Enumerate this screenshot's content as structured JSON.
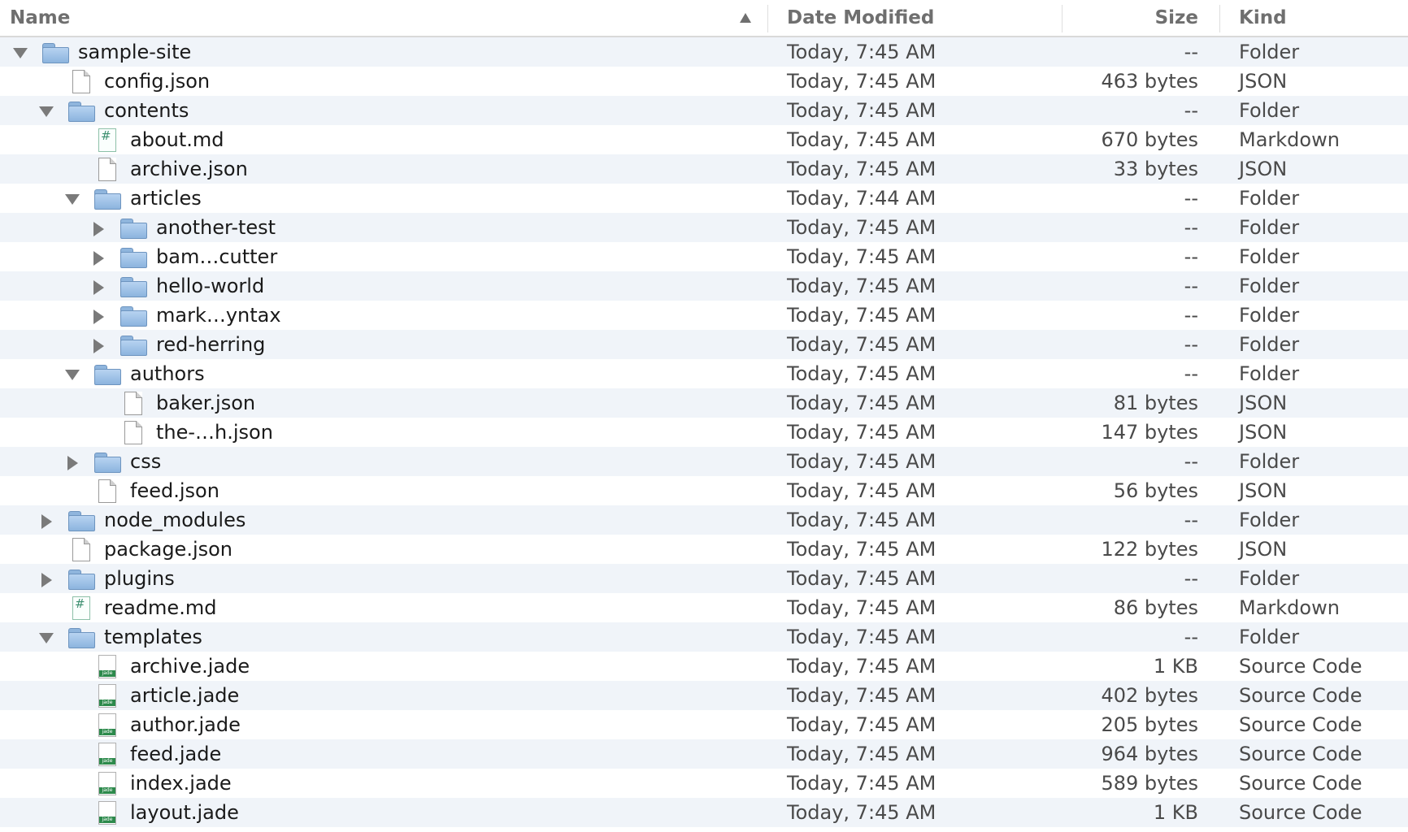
{
  "header": {
    "name": "Name",
    "date": "Date Modified",
    "size": "Size",
    "kind": "Kind"
  },
  "rows": [
    {
      "name": "sample-site",
      "date": "Today, 7:45 AM",
      "size": "--",
      "kind": "Folder",
      "depth": 0,
      "type": "folder",
      "disclosure": "open"
    },
    {
      "name": "config.json",
      "date": "Today, 7:45 AM",
      "size": "463 bytes",
      "kind": "JSON",
      "depth": 1,
      "type": "file",
      "disclosure": "none"
    },
    {
      "name": "contents",
      "date": "Today, 7:45 AM",
      "size": "--",
      "kind": "Folder",
      "depth": 1,
      "type": "folder",
      "disclosure": "open"
    },
    {
      "name": "about.md",
      "date": "Today, 7:45 AM",
      "size": "670 bytes",
      "kind": "Markdown",
      "depth": 2,
      "type": "md",
      "disclosure": "none"
    },
    {
      "name": "archive.json",
      "date": "Today, 7:45 AM",
      "size": "33 bytes",
      "kind": "JSON",
      "depth": 2,
      "type": "file",
      "disclosure": "none"
    },
    {
      "name": "articles",
      "date": "Today, 7:44 AM",
      "size": "--",
      "kind": "Folder",
      "depth": 2,
      "type": "folder",
      "disclosure": "open"
    },
    {
      "name": "another-test",
      "date": "Today, 7:45 AM",
      "size": "--",
      "kind": "Folder",
      "depth": 3,
      "type": "folder",
      "disclosure": "closed"
    },
    {
      "name": "bam…cutter",
      "date": "Today, 7:45 AM",
      "size": "--",
      "kind": "Folder",
      "depth": 3,
      "type": "folder",
      "disclosure": "closed"
    },
    {
      "name": "hello-world",
      "date": "Today, 7:45 AM",
      "size": "--",
      "kind": "Folder",
      "depth": 3,
      "type": "folder",
      "disclosure": "closed"
    },
    {
      "name": "mark…yntax",
      "date": "Today, 7:45 AM",
      "size": "--",
      "kind": "Folder",
      "depth": 3,
      "type": "folder",
      "disclosure": "closed"
    },
    {
      "name": "red-herring",
      "date": "Today, 7:45 AM",
      "size": "--",
      "kind": "Folder",
      "depth": 3,
      "type": "folder",
      "disclosure": "closed"
    },
    {
      "name": "authors",
      "date": "Today, 7:45 AM",
      "size": "--",
      "kind": "Folder",
      "depth": 2,
      "type": "folder",
      "disclosure": "open"
    },
    {
      "name": "baker.json",
      "date": "Today, 7:45 AM",
      "size": "81 bytes",
      "kind": "JSON",
      "depth": 3,
      "type": "file",
      "disclosure": "none"
    },
    {
      "name": "the-…h.json",
      "date": "Today, 7:45 AM",
      "size": "147 bytes",
      "kind": "JSON",
      "depth": 3,
      "type": "file",
      "disclosure": "none"
    },
    {
      "name": "css",
      "date": "Today, 7:45 AM",
      "size": "--",
      "kind": "Folder",
      "depth": 2,
      "type": "folder",
      "disclosure": "closed"
    },
    {
      "name": "feed.json",
      "date": "Today, 7:45 AM",
      "size": "56 bytes",
      "kind": "JSON",
      "depth": 2,
      "type": "file",
      "disclosure": "none"
    },
    {
      "name": "node_modules",
      "date": "Today, 7:45 AM",
      "size": "--",
      "kind": "Folder",
      "depth": 1,
      "type": "folder",
      "disclosure": "closed"
    },
    {
      "name": "package.json",
      "date": "Today, 7:45 AM",
      "size": "122 bytes",
      "kind": "JSON",
      "depth": 1,
      "type": "file",
      "disclosure": "none"
    },
    {
      "name": "plugins",
      "date": "Today, 7:45 AM",
      "size": "--",
      "kind": "Folder",
      "depth": 1,
      "type": "folder",
      "disclosure": "closed"
    },
    {
      "name": "readme.md",
      "date": "Today, 7:45 AM",
      "size": "86 bytes",
      "kind": "Markdown",
      "depth": 1,
      "type": "md",
      "disclosure": "none"
    },
    {
      "name": "templates",
      "date": "Today, 7:45 AM",
      "size": "--",
      "kind": "Folder",
      "depth": 1,
      "type": "folder",
      "disclosure": "open"
    },
    {
      "name": "archive.jade",
      "date": "Today, 7:45 AM",
      "size": "1 KB",
      "kind": "Source Code",
      "depth": 2,
      "type": "jade",
      "disclosure": "none"
    },
    {
      "name": "article.jade",
      "date": "Today, 7:45 AM",
      "size": "402 bytes",
      "kind": "Source Code",
      "depth": 2,
      "type": "jade",
      "disclosure": "none"
    },
    {
      "name": "author.jade",
      "date": "Today, 7:45 AM",
      "size": "205 bytes",
      "kind": "Source Code",
      "depth": 2,
      "type": "jade",
      "disclosure": "none"
    },
    {
      "name": "feed.jade",
      "date": "Today, 7:45 AM",
      "size": "964 bytes",
      "kind": "Source Code",
      "depth": 2,
      "type": "jade",
      "disclosure": "none"
    },
    {
      "name": "index.jade",
      "date": "Today, 7:45 AM",
      "size": "589 bytes",
      "kind": "Source Code",
      "depth": 2,
      "type": "jade",
      "disclosure": "none"
    },
    {
      "name": "layout.jade",
      "date": "Today, 7:45 AM",
      "size": "1 KB",
      "kind": "Source Code",
      "depth": 2,
      "type": "jade",
      "disclosure": "none"
    }
  ]
}
